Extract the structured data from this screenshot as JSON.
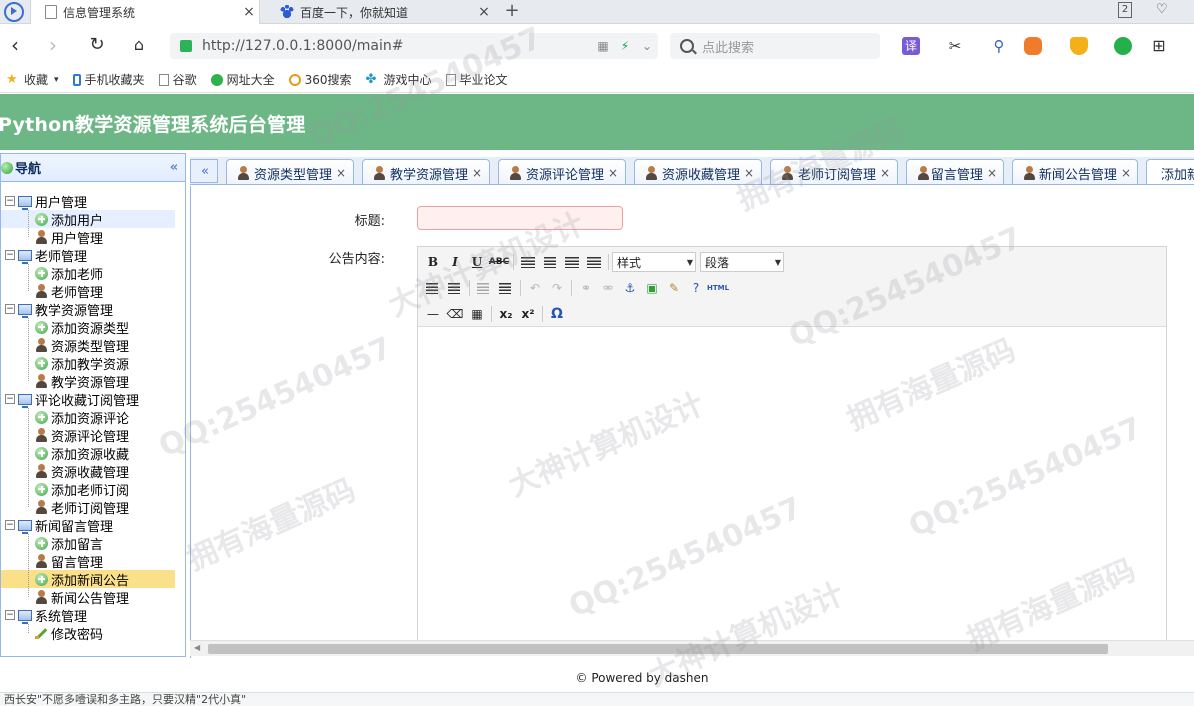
{
  "browser": {
    "tabs": [
      {
        "title": "信息管理系统",
        "close": "×"
      },
      {
        "title": "百度一下，你就知道",
        "close": "×"
      }
    ],
    "new_tab": "+",
    "tab_count": "2",
    "url": "http://127.0.0.1:8000/main#",
    "search_placeholder": "点此搜索",
    "toolbar_icons": [
      "translate-icon",
      "scissors-icon",
      "search-icon",
      "game-icon",
      "shield-icon",
      "wechat-icon",
      "grid-icon"
    ],
    "translate_label": "译",
    "bookmarks": [
      {
        "label": "收藏",
        "icon": "star-icon"
      },
      {
        "label": "手机收藏夹",
        "icon": "phone-icon"
      },
      {
        "label": "谷歌",
        "icon": "page-icon"
      },
      {
        "label": "网址大全",
        "icon": "globe-icon"
      },
      {
        "label": "360搜索",
        "icon": "360-icon"
      },
      {
        "label": "游戏中心",
        "icon": "game-icon"
      },
      {
        "label": "毕业论文",
        "icon": "page-icon"
      }
    ]
  },
  "app": {
    "title": "Python教学资源管理系统后台管理"
  },
  "nav": {
    "title": "导航",
    "collapse": "«",
    "groups": [
      {
        "label": "用户管理",
        "toggle": "−",
        "items": [
          {
            "label": "添加用户",
            "icon": "add-icon"
          },
          {
            "label": "用户管理",
            "icon": "user-icon"
          }
        ]
      },
      {
        "label": "老师管理",
        "toggle": "−",
        "items": [
          {
            "label": "添加老师",
            "icon": "add-icon"
          },
          {
            "label": "老师管理",
            "icon": "user-icon"
          }
        ]
      },
      {
        "label": "教学资源管理",
        "toggle": "−",
        "items": [
          {
            "label": "添加资源类型",
            "icon": "add-icon"
          },
          {
            "label": "资源类型管理",
            "icon": "user-icon"
          },
          {
            "label": "添加教学资源",
            "icon": "add-icon"
          },
          {
            "label": "教学资源管理",
            "icon": "user-icon"
          }
        ]
      },
      {
        "label": "评论收藏订阅管理",
        "toggle": "−",
        "items": [
          {
            "label": "添加资源评论",
            "icon": "add-icon"
          },
          {
            "label": "资源评论管理",
            "icon": "user-icon"
          },
          {
            "label": "添加资源收藏",
            "icon": "add-icon"
          },
          {
            "label": "资源收藏管理",
            "icon": "user-icon"
          },
          {
            "label": "添加老师订阅",
            "icon": "add-icon"
          },
          {
            "label": "老师订阅管理",
            "icon": "user-icon"
          }
        ]
      },
      {
        "label": "新闻留言管理",
        "toggle": "−",
        "items": [
          {
            "label": "添加留言",
            "icon": "add-icon"
          },
          {
            "label": "留言管理",
            "icon": "user-icon"
          },
          {
            "label": "添加新闻公告",
            "icon": "add-icon"
          },
          {
            "label": "新闻公告管理",
            "icon": "user-icon"
          }
        ]
      },
      {
        "label": "系统管理",
        "toggle": "−",
        "items": [
          {
            "label": "修改密码",
            "icon": "key-icon"
          }
        ]
      }
    ]
  },
  "tabs": {
    "scroll_left": "«",
    "items": [
      {
        "label": "资源类型管理",
        "close": "×"
      },
      {
        "label": "教学资源管理",
        "close": "×"
      },
      {
        "label": "资源评论管理",
        "close": "×"
      },
      {
        "label": "资源收藏管理",
        "close": "×"
      },
      {
        "label": "老师订阅管理",
        "close": "×"
      },
      {
        "label": "留言管理",
        "close": "×"
      },
      {
        "label": "新闻公告管理",
        "close": "×"
      },
      {
        "label": "添加新闻公告",
        "close": "×"
      }
    ]
  },
  "form": {
    "title_label": "标题:",
    "title_value": "",
    "content_label": "公告内容:",
    "editor": {
      "style_select": "样式",
      "format_select": "段落",
      "buttons_row1": [
        "B",
        "I",
        "U",
        "ABC"
      ],
      "html_label": "HTML",
      "omega": "Ω",
      "sub_label": "x₂",
      "sup_label": "x²"
    }
  },
  "footer": {
    "text": "© Powered by dashen"
  },
  "statusbar": {
    "text": "西长安\"不愿多噎误和多主路，只要汉精\"2代小真\""
  },
  "watermarks": [
    "QQ:254540457",
    "拥有海量源码",
    "大神计算机设计"
  ]
}
